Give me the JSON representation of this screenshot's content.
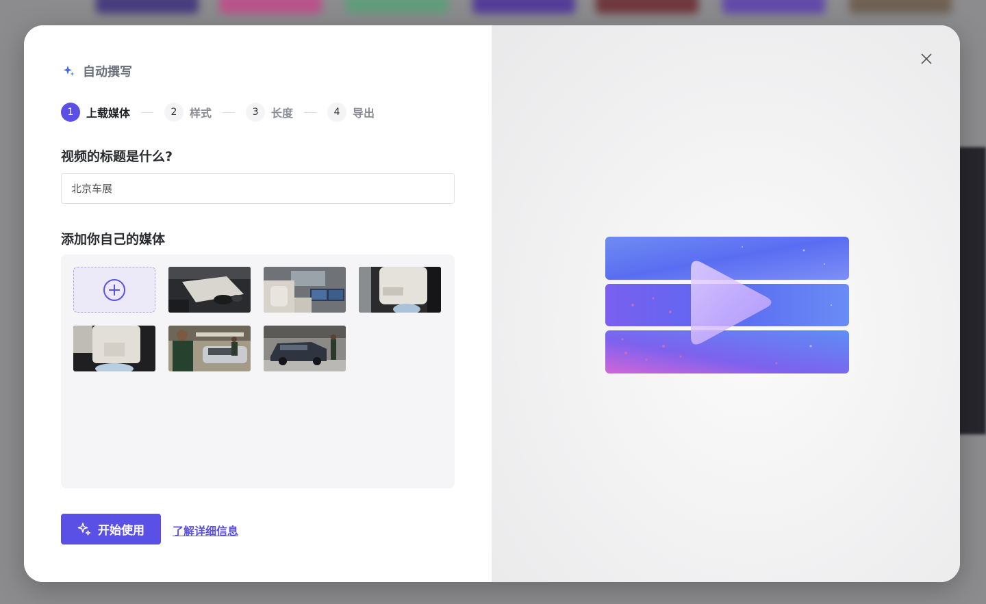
{
  "dialog": {
    "app_title": "自动撰写",
    "steps": [
      {
        "number": "1",
        "label": "上载媒体",
        "active": true
      },
      {
        "number": "2",
        "label": "样式",
        "active": false
      },
      {
        "number": "3",
        "label": "长度",
        "active": false
      },
      {
        "number": "4",
        "label": "导出",
        "active": false
      }
    ],
    "title_question": "视频的标题是什么?",
    "title_input_value": "北京车展",
    "media_question": "添加你自己的媒体",
    "media": {
      "add_icon": "plus-circle-icon",
      "thumbnails": [
        "car-interior-console",
        "car-interior-seats-screen",
        "car-rear-seat",
        "car-seat-back",
        "people-at-car-show",
        "suv-at-car-show"
      ]
    },
    "start_button_label": "开始使用",
    "learn_more_label": "了解详细信息",
    "close_icon": "close-icon",
    "hero_icon": "video-play-illustration"
  },
  "colors": {
    "accent": "#5b50e6",
    "step_inactive_text": "#8a8d96",
    "heading_text": "#2a2b30"
  }
}
